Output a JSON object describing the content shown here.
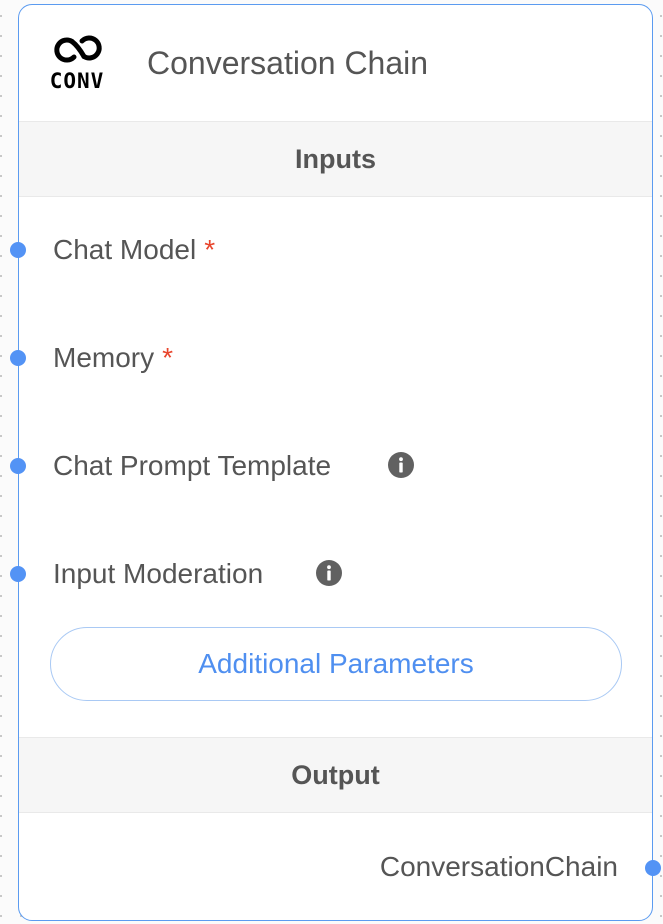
{
  "node": {
    "logo_text": "CONV",
    "logo_icon": "chain-link-icon",
    "title": "Conversation Chain"
  },
  "inputs_section": {
    "title": "Inputs",
    "items": [
      {
        "label": "Chat Model",
        "required": true,
        "info": false
      },
      {
        "label": "Memory",
        "required": true,
        "info": false
      },
      {
        "label": "Chat Prompt Template",
        "required": false,
        "info": true
      },
      {
        "label": "Input Moderation",
        "required": false,
        "info": true
      }
    ],
    "required_marker": "*",
    "info_icon": "info-icon"
  },
  "additional_parameters_label": "Additional Parameters",
  "output_section": {
    "title": "Output",
    "items": [
      {
        "label": "ConversationChain"
      }
    ]
  },
  "colors": {
    "accent": "#5393f5",
    "border": "#5b9bf0",
    "required": "#e8452c",
    "text": "#555555",
    "section_bg": "#f6f6f6"
  }
}
